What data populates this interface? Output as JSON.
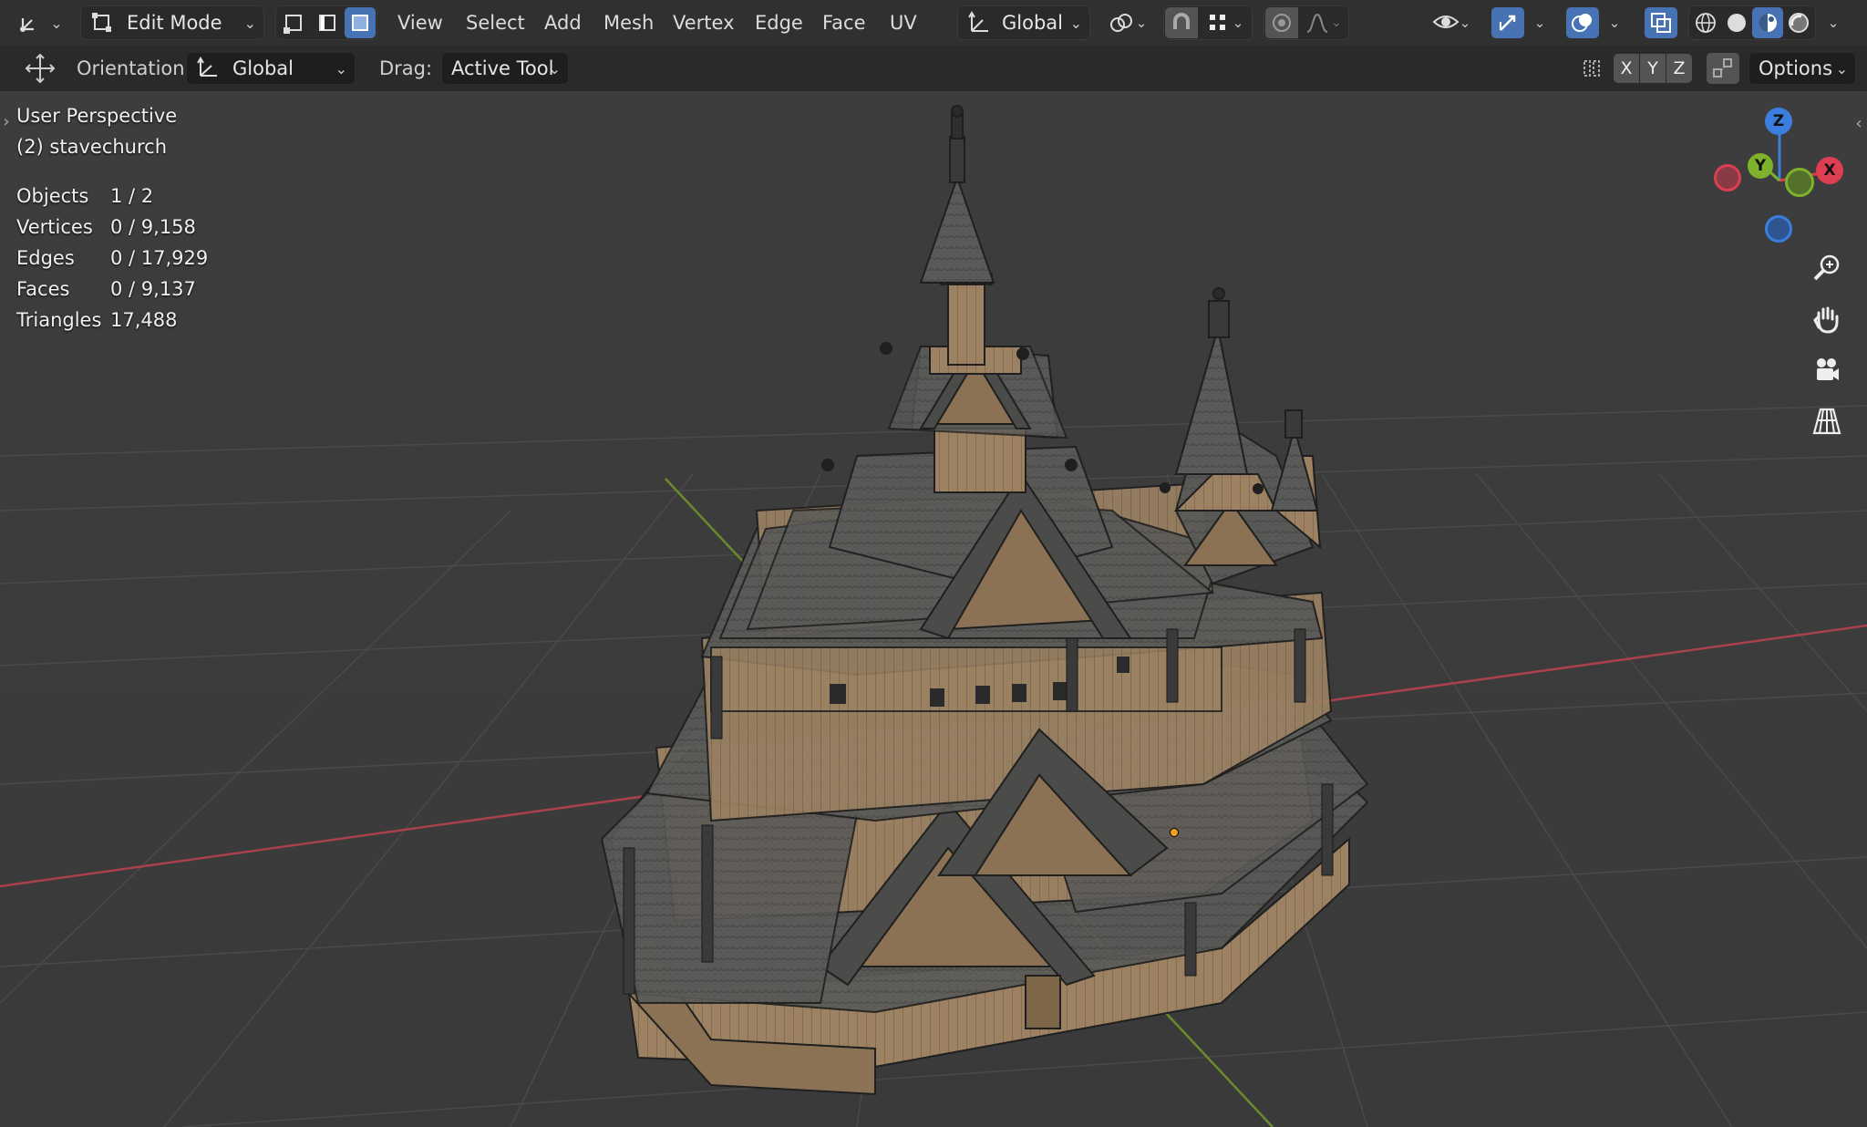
{
  "header": {
    "mode": "Edit Mode",
    "menus": [
      "View",
      "Select",
      "Add",
      "Mesh",
      "Vertex",
      "Edge",
      "Face",
      "UV"
    ],
    "transform_orientation": "Global"
  },
  "toolbar": {
    "orientation_label": "Orientation:",
    "orientation_value": "Global",
    "drag_label": "Drag:",
    "drag_value": "Active Tool",
    "axis_x": "X",
    "axis_y": "Y",
    "axis_z": "Z",
    "options_label": "Options"
  },
  "viewport": {
    "view_name": "User Perspective",
    "object_name": "(2) stavechurch",
    "stats": [
      {
        "label": "Objects",
        "value": "1 / 2"
      },
      {
        "label": "Vertices",
        "value": "0 / 9,158"
      },
      {
        "label": "Edges",
        "value": "0 / 17,929"
      },
      {
        "label": "Faces",
        "value": "0 / 9,137"
      },
      {
        "label": "Triangles",
        "value": "17,488"
      }
    ]
  },
  "gizmo": {
    "x": "X",
    "y": "Y",
    "z": "Z"
  },
  "colors": {
    "accent": "#4772b3",
    "x_axis": "#dd3e52",
    "y_axis": "#7eb12c",
    "z_axis": "#3a7ee0",
    "viewport_bg": "#3d3d3d",
    "header_bg": "#303030"
  },
  "icons": [
    "editor-type-icon",
    "edit-mode-icon",
    "vertex-select-icon",
    "edge-select-icon",
    "face-select-icon",
    "transform-orientation-icon",
    "pivot-icon",
    "snap-icon",
    "snap-target-icon",
    "proportional-edit-icon",
    "falloff-icon",
    "visibility-icon",
    "gizmo-icon",
    "overlay-icon",
    "xray-icon",
    "wireframe-shading-icon",
    "solid-shading-icon",
    "material-shading-icon",
    "rendered-shading-icon",
    "move-tool-icon",
    "mirror-icon",
    "auto-merge-icon",
    "zoom-icon",
    "pan-hand-icon",
    "camera-icon",
    "grid-icon"
  ]
}
